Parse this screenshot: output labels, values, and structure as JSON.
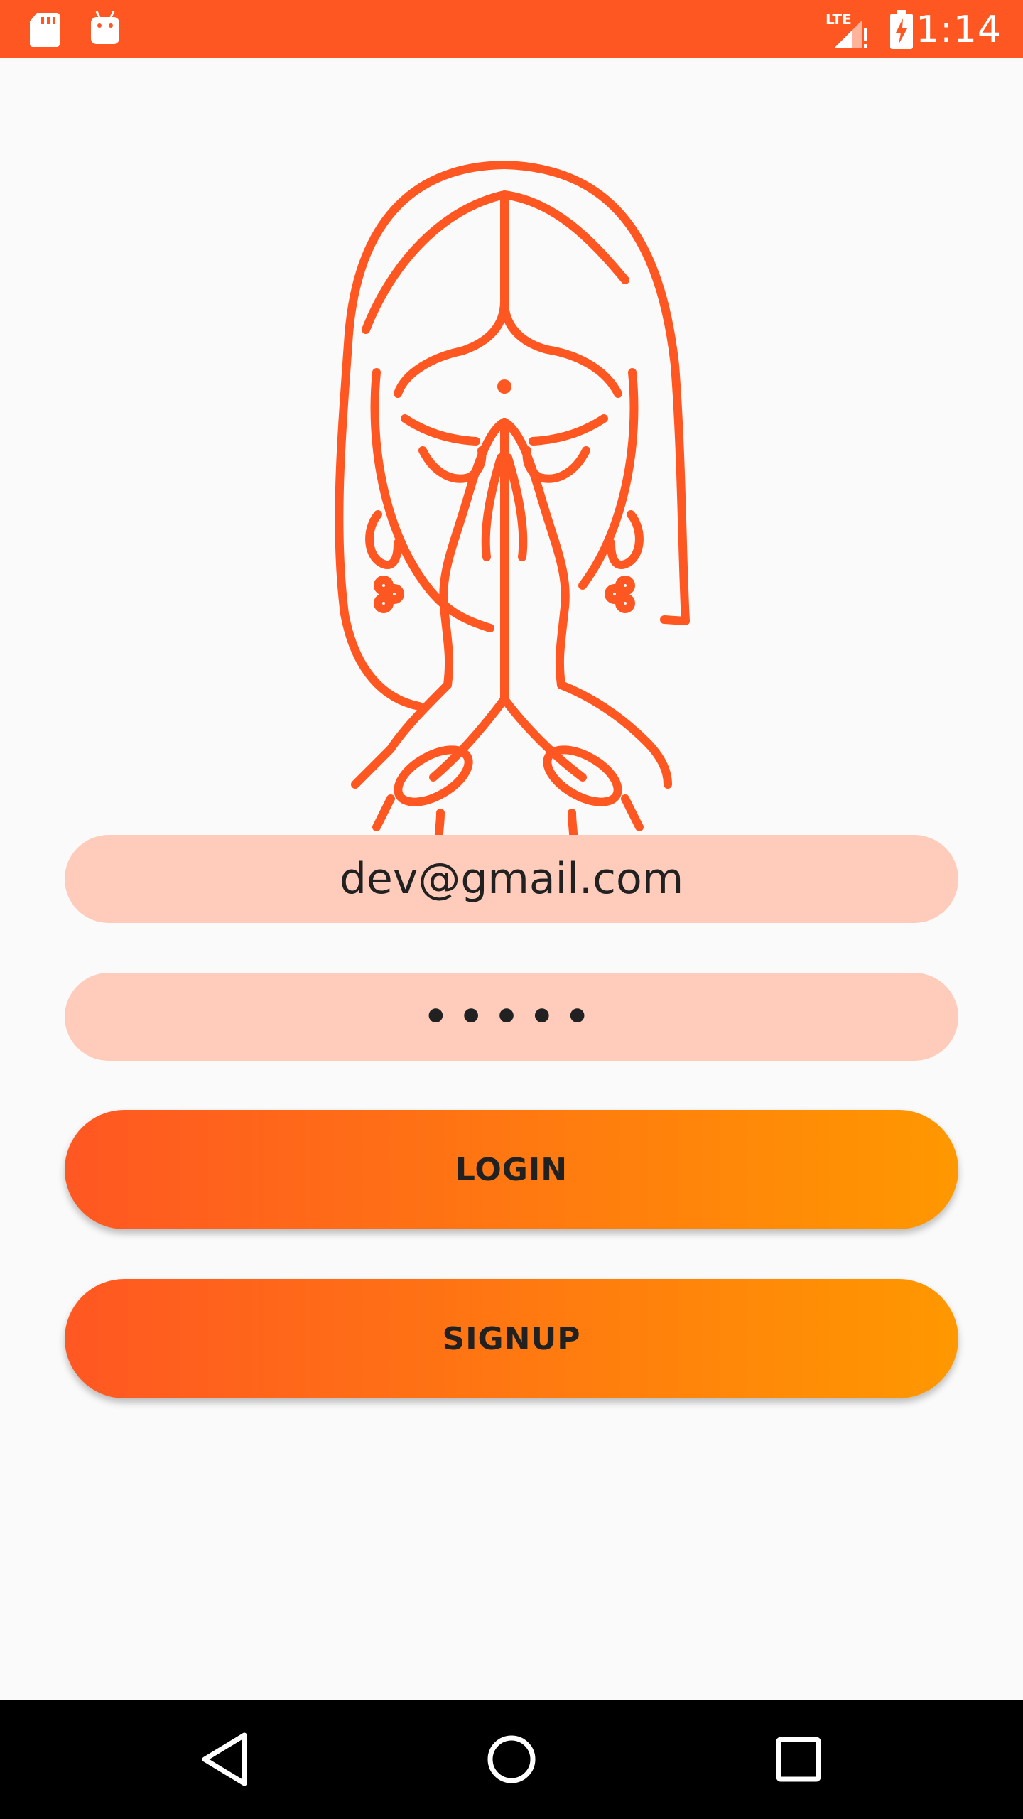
{
  "status_bar": {
    "time": "1:14",
    "network_label": "LTE",
    "icons": [
      "sd-card-icon",
      "android-icon",
      "signal-icon",
      "battery-charging-icon"
    ]
  },
  "logo": {
    "icon": "namaste-woman-logo"
  },
  "login_form": {
    "email_value": "dev@gmail.com",
    "password_mask": "•••••"
  },
  "buttons": {
    "login_label": "LOGIN",
    "signup_label": "SIGNUP"
  },
  "nav_bar": {
    "icons": [
      "back-icon",
      "home-icon",
      "recents-icon"
    ]
  },
  "colors": {
    "primary": "#FF5722",
    "accent": "#FF9800",
    "field_background": "#FFCCBC",
    "background": "#FAFAFA"
  }
}
